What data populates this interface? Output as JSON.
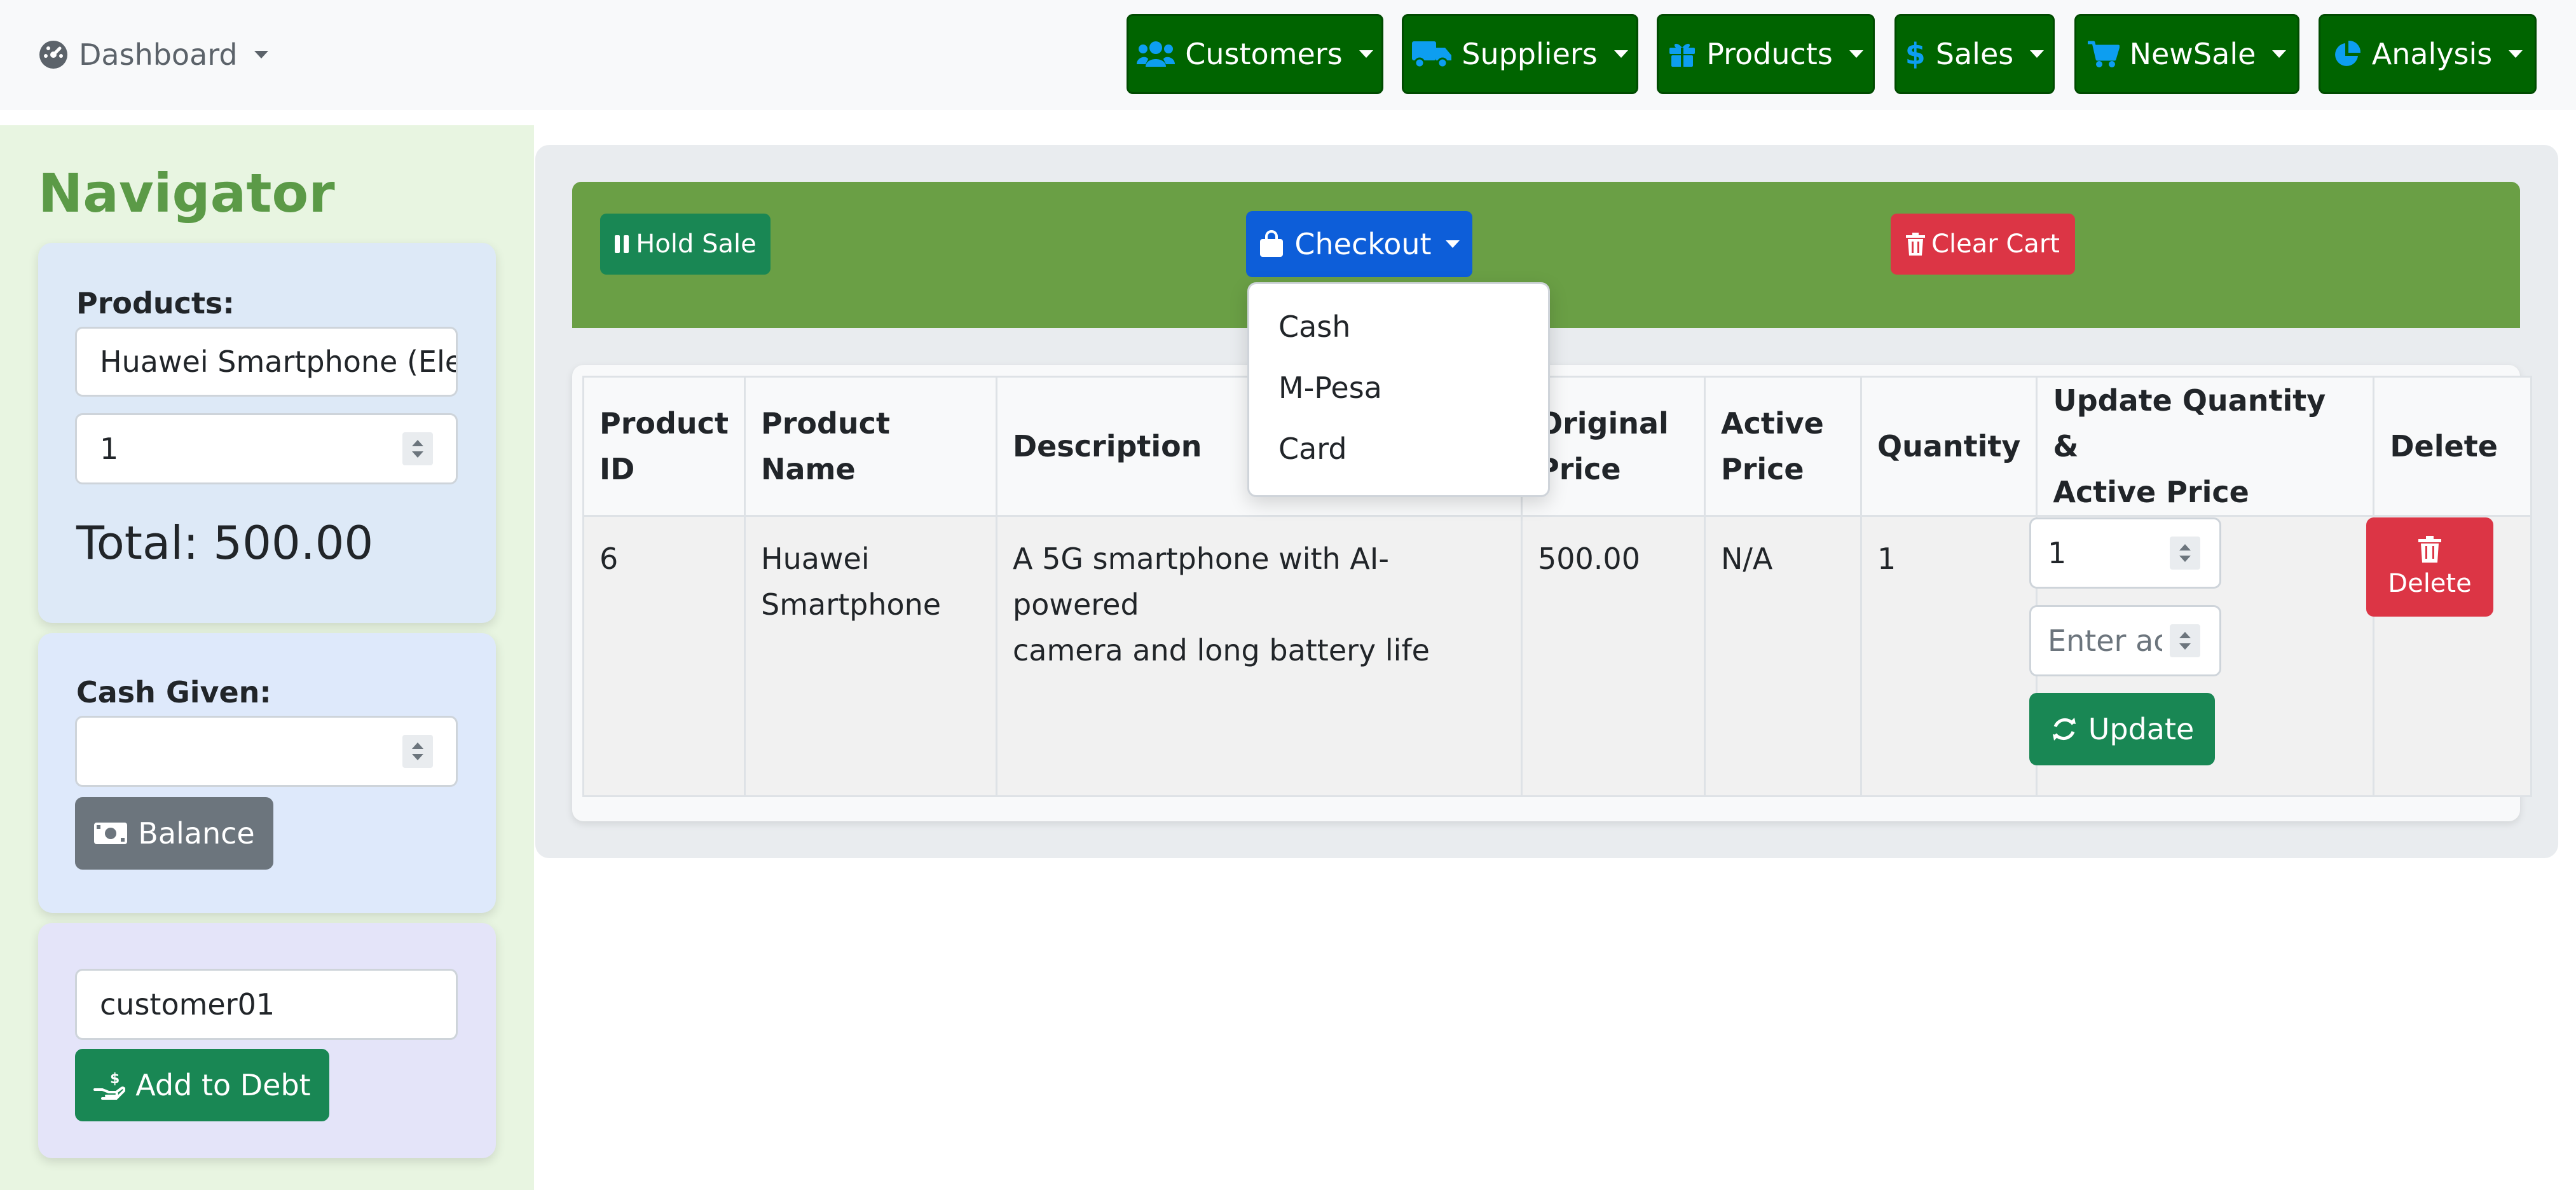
{
  "navbar": {
    "brand": "Dashboard",
    "menus": [
      {
        "label": "Customers",
        "icon": "users-icon"
      },
      {
        "label": "Suppliers",
        "icon": "truck-icon"
      },
      {
        "label": "Products",
        "icon": "gift-icon"
      },
      {
        "label": "Sales",
        "icon": "dollar-icon"
      },
      {
        "label": "NewSale",
        "icon": "cart-icon"
      },
      {
        "label": "Analysis",
        "icon": "pie-chart-icon"
      }
    ]
  },
  "sidebar": {
    "title": "Navigator",
    "products_label": "Products:",
    "product_value": "Huawei Smartphone (Electronics)",
    "quantity_value": "1",
    "total": "Total: 500.00",
    "cash_label": "Cash Given:",
    "cash_value": "",
    "balance_button": "Balance",
    "customer_value": "customer01",
    "debt_button": "Add to Debt"
  },
  "actions": {
    "hold": "Hold Sale",
    "checkout": "Checkout",
    "clear": "Clear Cart",
    "checkout_options": [
      "Cash",
      "M-Pesa",
      "Card"
    ]
  },
  "table": {
    "headers": {
      "id": [
        "Product",
        "ID"
      ],
      "name": "Product Name",
      "desc": "Description",
      "orig": [
        "Original",
        "Price"
      ],
      "active": [
        "Active",
        "Price"
      ],
      "qty": "Quantity",
      "update": [
        "Update Quantity &",
        "Active Price"
      ],
      "delete": "Delete"
    },
    "rows": [
      {
        "id": "6",
        "name": [
          "Huawei",
          "Smartphone"
        ],
        "desc": [
          "A 5G smartphone with AI-powered",
          "camera and long battery life"
        ],
        "orig": "500.00",
        "active": "N/A",
        "qty": "1",
        "qty_input": "1",
        "price_placeholder": "Enter active price",
        "update_button": "Update",
        "delete_button": "Delete"
      }
    ]
  },
  "colors": {
    "nav_green": "#006400",
    "action_bar": "#6a9f45",
    "success": "#198754",
    "primary": "#0d6efd",
    "danger": "#dc3545",
    "secondary": "#6c757d"
  }
}
